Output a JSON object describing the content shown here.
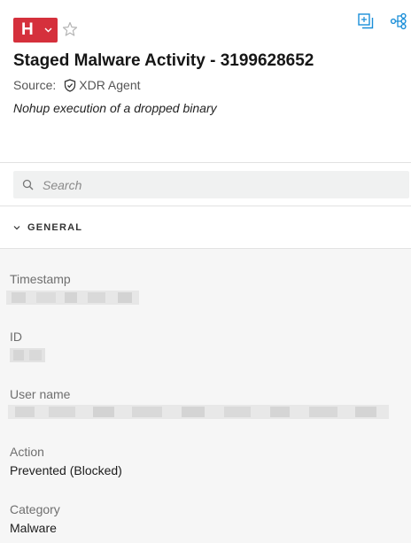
{
  "header": {
    "severity_letter": "H",
    "title": "Staged Malware Activity - 3199628652",
    "source_label": "Source:",
    "source_value": "XDR Agent",
    "description": "Nohup execution of a dropped binary"
  },
  "icons": {
    "severity": "chevron-down-icon",
    "favorite": "star-outline-icon",
    "copy": "copy-icon",
    "graph": "causality-graph-icon",
    "source": "shield-icon",
    "search": "search-icon",
    "section": "chevron-down-icon"
  },
  "colors": {
    "severity_high": "#d5303c",
    "accent": "#1a8ed8",
    "body_background": "#f6f6f6"
  },
  "search": {
    "placeholder": "Search",
    "value": ""
  },
  "section": {
    "title": "GENERAL"
  },
  "fields": {
    "timestamp": {
      "label": "Timestamp"
    },
    "id": {
      "label": "ID"
    },
    "user_name": {
      "label": "User name"
    },
    "action": {
      "label": "Action",
      "value": "Prevented (Blocked)"
    },
    "category": {
      "label": "Category",
      "value": "Malware"
    }
  }
}
